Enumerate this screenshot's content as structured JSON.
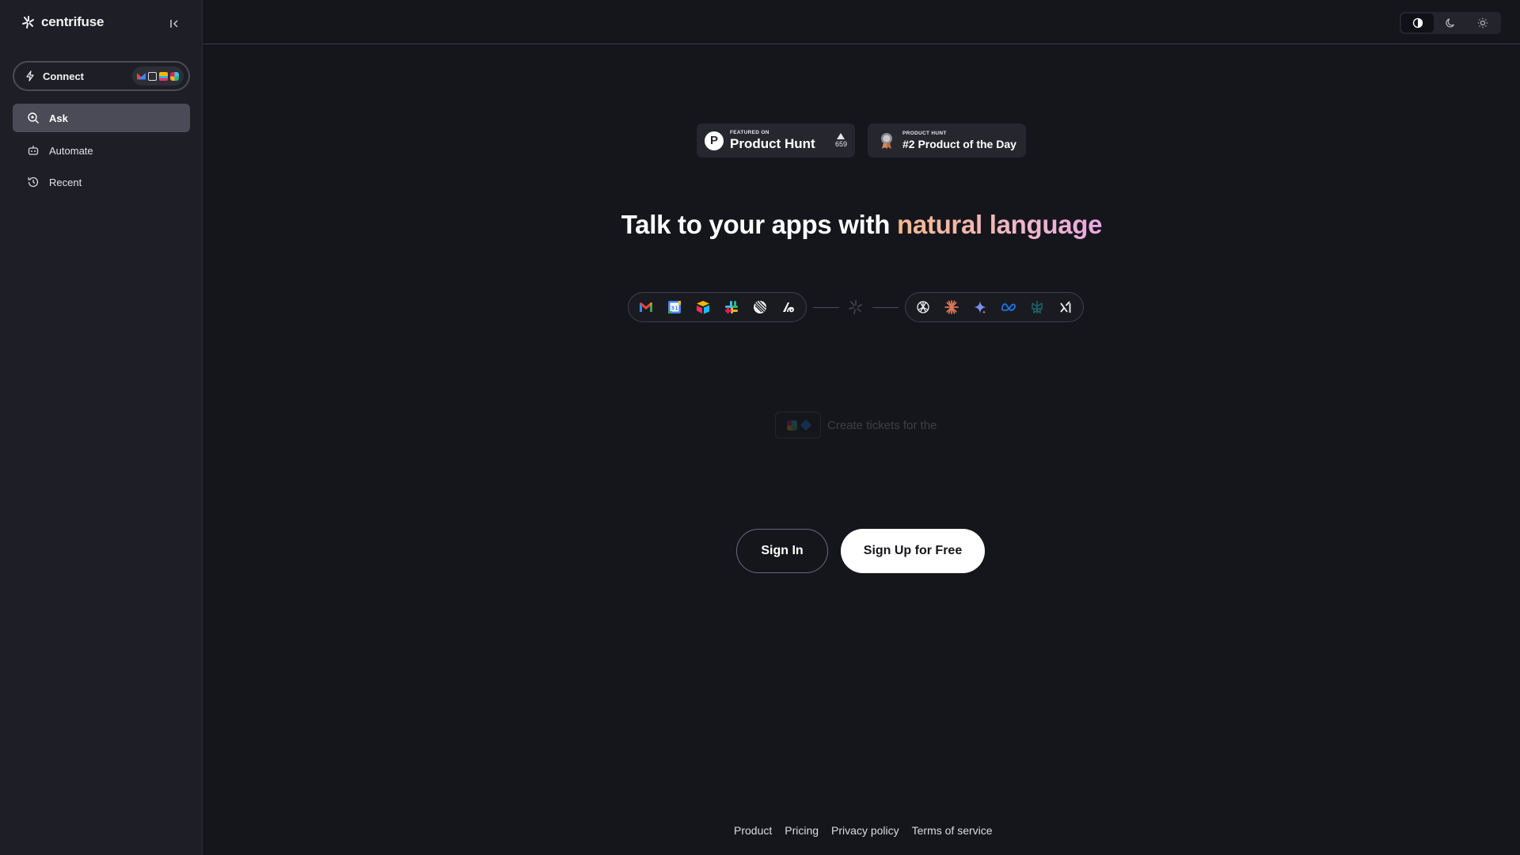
{
  "sidebar": {
    "brand": "centrifuse",
    "connect_label": "Connect",
    "connect_apps": [
      "gmail-icon",
      "notion-icon",
      "airtable-icon",
      "slack-icon"
    ],
    "items": [
      {
        "label": "Ask",
        "icon": "search-chat-icon",
        "active": true
      },
      {
        "label": "Automate",
        "icon": "robot-icon",
        "active": false
      },
      {
        "label": "Recent",
        "icon": "history-icon",
        "active": false
      }
    ]
  },
  "topbar": {
    "theme_options": [
      "contrast-icon",
      "moon-icon",
      "sun-icon"
    ],
    "active_theme": "contrast-icon"
  },
  "main": {
    "badge_featured": {
      "small": "FEATURED ON",
      "big": "Product Hunt",
      "votes": "659"
    },
    "badge_rank": {
      "small": "PRODUCT HUNT",
      "big": "#2 Product of the Day"
    },
    "headline_plain": "Talk to your apps with ",
    "headline_highlight": "natural language",
    "left_apps": [
      "gmail-icon",
      "google-calendar-icon",
      "airtable-icon",
      "slack-icon",
      "linear-icon",
      "zapier-icon"
    ],
    "right_models": [
      "openai-icon",
      "claude-icon",
      "gemini-icon",
      "meta-icon",
      "perplexity-icon",
      "xai-icon"
    ],
    "ghost_prompt": "Create tickets for the",
    "signin_label": "Sign In",
    "signup_label": "Sign Up for Free"
  },
  "footer": {
    "links": [
      "Product",
      "Pricing",
      "Privacy policy",
      "Terms of service"
    ]
  },
  "colors": {
    "background": "#15161b",
    "sidebar": "#1e1f26",
    "active_nav": "#4a4b57",
    "headline_gradient_start": "#f5b98c",
    "headline_gradient_end": "#e9a8e2"
  }
}
